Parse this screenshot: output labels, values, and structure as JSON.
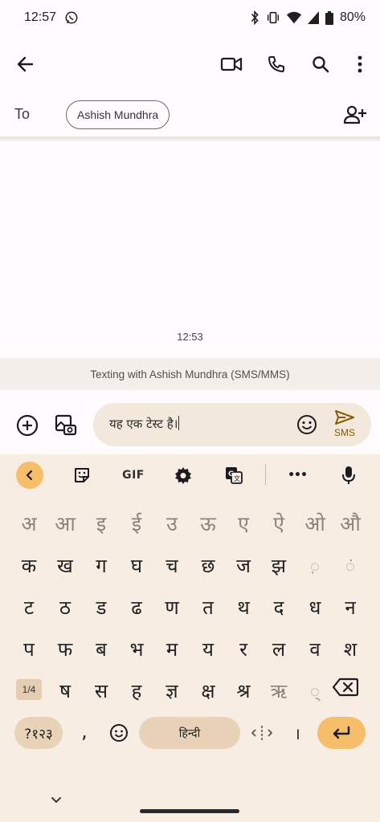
{
  "status_bar": {
    "time": "12:57",
    "battery": "80%"
  },
  "recipient": {
    "to_label": "To",
    "name": "Ashish Mundhra"
  },
  "conversation": {
    "timestamp": "12:53",
    "texting_info": "Texting with Ashish Mundhra (SMS/MMS)"
  },
  "compose": {
    "message_text": "यह एक टेस्ट है।",
    "send_label": "SMS"
  },
  "keyboard": {
    "toolbar": {
      "gif_label": "GIF",
      "more_label": "•••"
    },
    "vowels": [
      "अ",
      "आ",
      "इ",
      "ई",
      "उ",
      "ऊ",
      "ए",
      "ऐ",
      "ओ",
      "औ"
    ],
    "row1": [
      "क",
      "ख",
      "ग",
      "घ",
      "च",
      "छ",
      "ज",
      "झ",
      "़",
      "ं"
    ],
    "row2": [
      "ट",
      "ठ",
      "ड",
      "ढ",
      "ण",
      "त",
      "थ",
      "द",
      "ध",
      "न"
    ],
    "row3": [
      "प",
      "फ",
      "ब",
      "भ",
      "म",
      "य",
      "र",
      "ल",
      "व",
      "श"
    ],
    "row4": [
      "ष",
      "स",
      "ह",
      "ज्ञ",
      "क्ष",
      "श्र",
      "ऋ",
      "्"
    ],
    "page_label": "1/4",
    "symbols_label": "?१२३",
    "comma": ",",
    "space_label": "हिन्दी",
    "danda": "।"
  },
  "colors": {
    "accent": "#f6bd6b",
    "key_surface": "#e8d3b8",
    "keyboard_bg": "#f8ede2",
    "compose_field": "#f3e8dc"
  }
}
